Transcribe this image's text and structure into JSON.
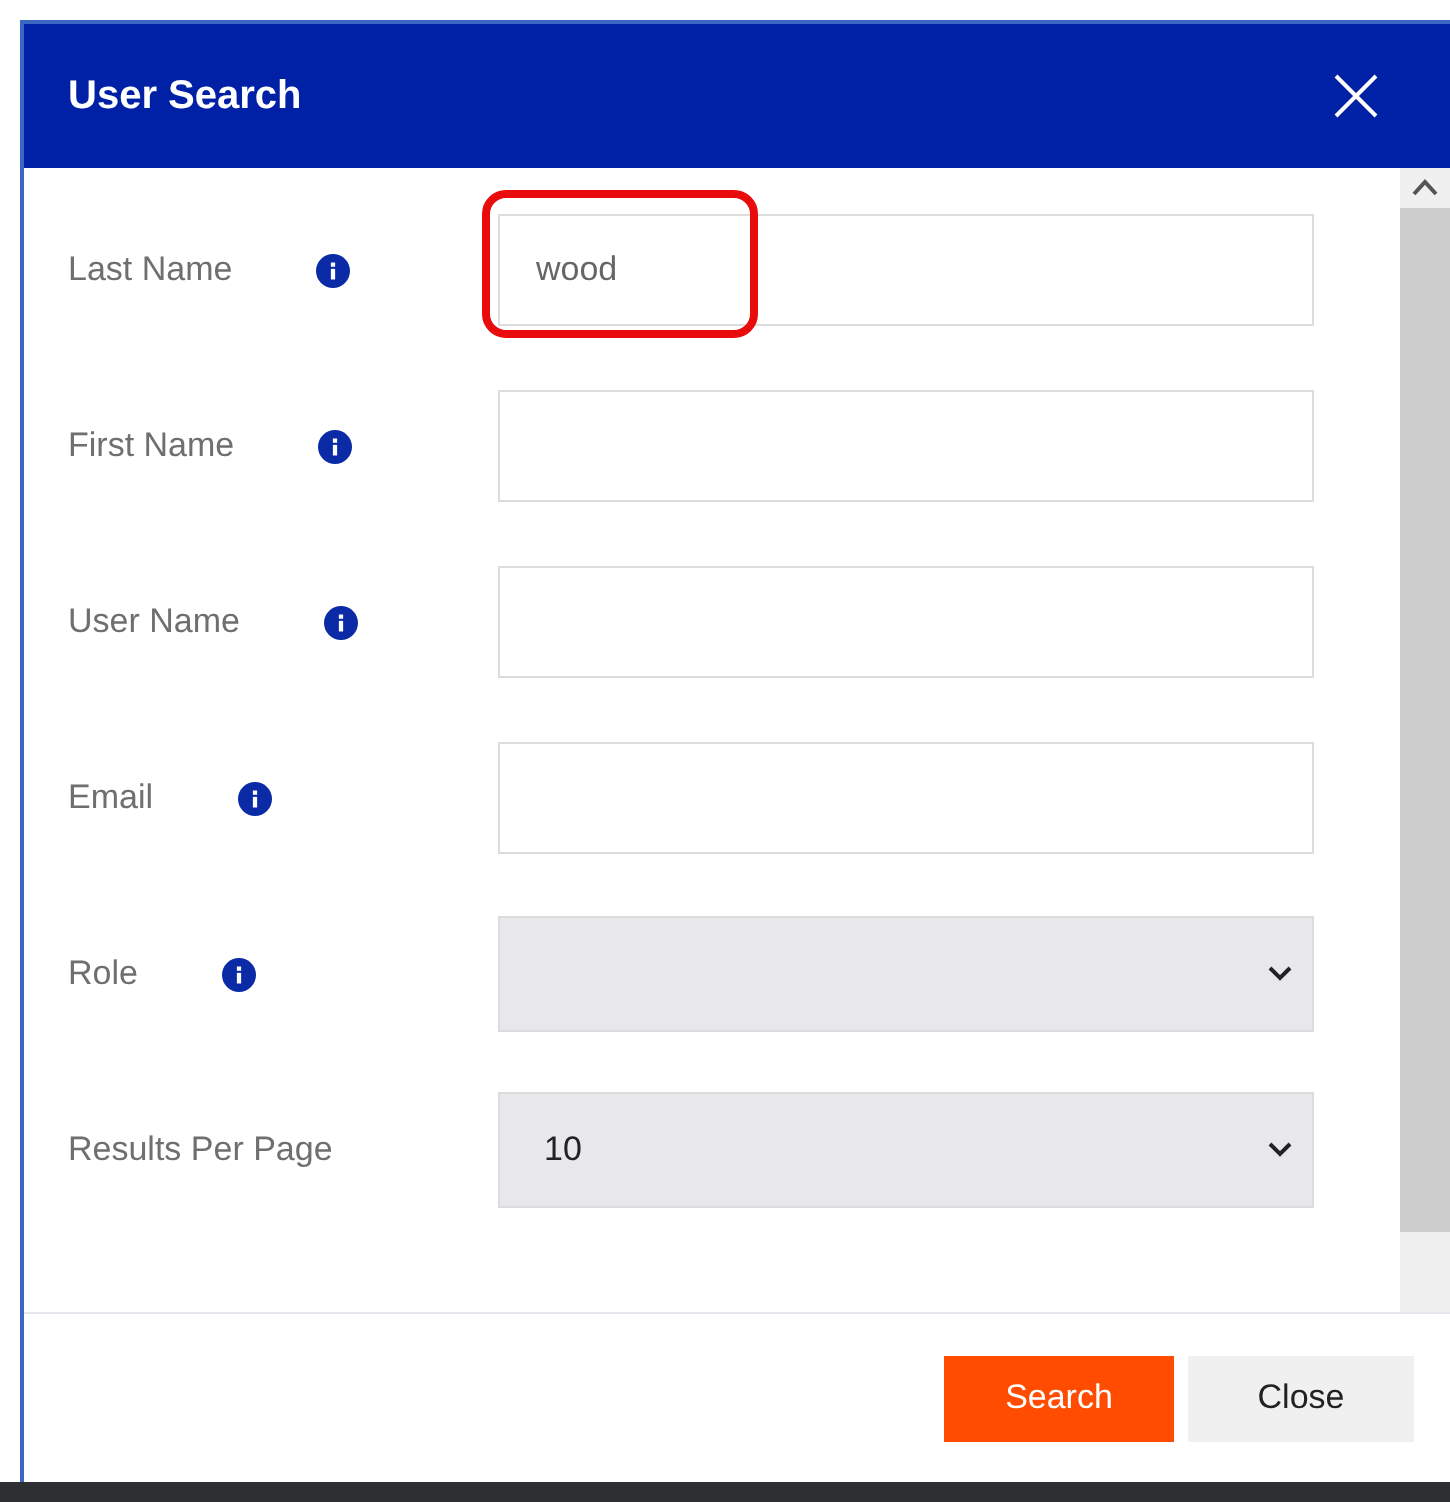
{
  "dialog": {
    "title": "User Search"
  },
  "fields": [
    {
      "kind": "text",
      "label": "Last Name",
      "info": true,
      "value": "wood",
      "highlighted": true
    },
    {
      "kind": "text",
      "label": "First Name",
      "info": true,
      "highlighted": false
    },
    {
      "kind": "text",
      "label": "User Name",
      "info": true,
      "highlighted": false
    },
    {
      "kind": "text",
      "label": "Email",
      "info": true,
      "highlighted": false
    },
    {
      "kind": "select",
      "label": "Role",
      "info": true,
      "highlighted": false
    },
    {
      "kind": "select",
      "label": "Results Per Page",
      "info": false,
      "value": "10",
      "highlighted": false
    }
  ],
  "buttons": [
    {
      "label": "Search",
      "kind": "primary"
    },
    {
      "label": "Close",
      "kind": "secondary"
    }
  ]
}
